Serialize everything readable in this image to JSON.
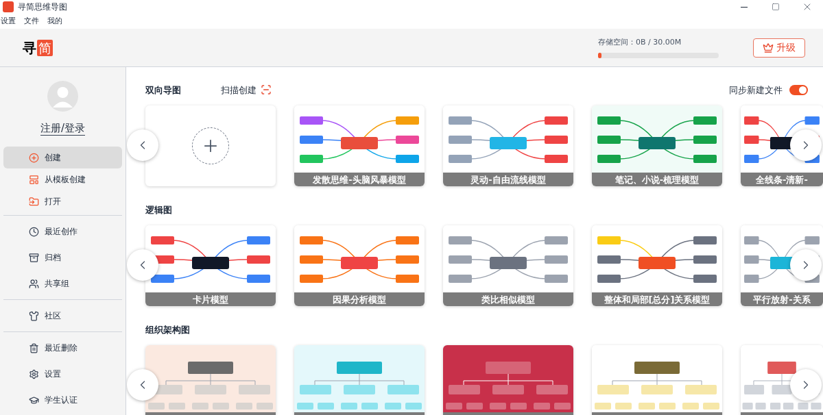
{
  "window": {
    "title": "寻简思维导图"
  },
  "menu": [
    "设置",
    "文件",
    "我的"
  ],
  "logo": {
    "first": "寻",
    "second": "简"
  },
  "storage": {
    "label": "存储空间：0B / 30.00M",
    "level": 0.03
  },
  "upgrade_button": "升级",
  "user": {
    "login": "注册/登录"
  },
  "sidebar": {
    "groups": [
      [
        {
          "label": "创建",
          "selected": true
        },
        {
          "label": "从模板创建",
          "selected": false
        },
        {
          "label": "打开",
          "selected": false
        }
      ],
      [
        {
          "label": "最近创作",
          "selected": false
        },
        {
          "label": "归档",
          "selected": false
        },
        {
          "label": "共享组",
          "selected": false
        }
      ],
      [
        {
          "label": "社区",
          "selected": false
        }
      ],
      [
        {
          "label": "最近删除",
          "selected": false
        },
        {
          "label": "设置",
          "selected": false
        },
        {
          "label": "学生认证",
          "selected": false
        }
      ]
    ]
  },
  "sections": [
    {
      "title": "双向导图",
      "action": "扫描创建",
      "sync": {
        "label": "同步新建文件",
        "on": true
      },
      "cards": [
        {
          "kind": "new"
        },
        {
          "kind": "picture",
          "caption": "发散思维-头脑风暴模型"
        },
        {
          "kind": "picture",
          "caption": "灵动-自由流线模型"
        },
        {
          "kind": "picture",
          "caption": "笔记、小说-梳理模型"
        },
        {
          "kind": "picture",
          "caption": "全线条-清新-"
        }
      ]
    },
    {
      "title": "逻辑图",
      "cards": [
        {
          "kind": "picture",
          "caption": "卡片模型"
        },
        {
          "kind": "picture",
          "caption": "因果分析模型"
        },
        {
          "kind": "picture",
          "caption": "类比相似模型"
        },
        {
          "kind": "picture",
          "caption": "整体和局部[总分]关系模型"
        },
        {
          "kind": "picture",
          "caption": "平行放射-关系"
        }
      ]
    },
    {
      "title": "组织架构图"
    }
  ]
}
